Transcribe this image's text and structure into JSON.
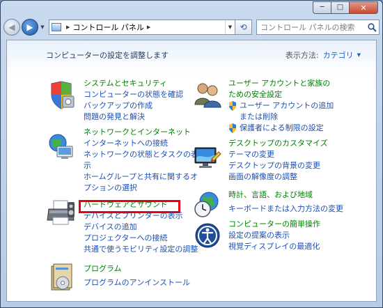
{
  "window": {
    "controls": {
      "minimize": "─",
      "maximize": "□",
      "close": "✕"
    }
  },
  "nav": {
    "back": "◀",
    "forward": "▶",
    "address_segments": [
      "コントロール パネル"
    ],
    "address_separator": "▶",
    "refresh": "⟲",
    "search_placeholder": "コントロール パネルの検索"
  },
  "content": {
    "heading": "コンピューターの設定を調整します",
    "view_by_label": "表示方法:",
    "view_by_value": "カテゴリ",
    "view_by_arrow": "▼",
    "categories": [
      {
        "icon": "shield-security-icon",
        "title": "システムとセキュリティ",
        "links": [
          "コンピューターの状態を確認",
          "バックアップの作成",
          "問題の発見と解決"
        ]
      },
      {
        "icon": "network-globe-icon",
        "title": "ネットワークとインターネット",
        "links": [
          "インターネットへの接続",
          "ネットワークの状態とタスクの表示",
          "ホームグループと共有に関するオプションの選択"
        ]
      },
      {
        "icon": "printer-icon",
        "title": "ハードウェアとサウンド",
        "links": [
          "デバイスとプリンターの表示",
          "デバイスの追加",
          "プロジェクターへの接続",
          "共通で使うモビリティ設定の調整"
        ]
      },
      {
        "icon": "programs-icon",
        "title": "プログラム",
        "links": [
          "プログラムのアンインストール"
        ]
      },
      {
        "icon": "users-icon",
        "title": "ユーザー アカウントと家族のための安全設定",
        "links": [
          "ユーザー アカウントの追加または削除",
          "保護者による制限の設定"
        ]
      },
      {
        "icon": "monitor-icon",
        "title": "デスクトップのカスタマイズ",
        "links": [
          "テーマの変更",
          "デスクトップの背景の変更",
          "画面の解像度の調整"
        ]
      },
      {
        "icon": "clock-globe-icon",
        "title": "時計、言語、および地域",
        "links": [
          "キーボードまたは入力方法の変更"
        ]
      },
      {
        "icon": "ease-of-access-icon",
        "title": "コンピューターの簡単操作",
        "links": [
          "設定の提案の表示",
          "視覚ディスプレイの最適化"
        ]
      }
    ]
  },
  "colors": {
    "category_title": "#008000",
    "link": "#1b4fb3",
    "highlight_box": "#e60012"
  }
}
